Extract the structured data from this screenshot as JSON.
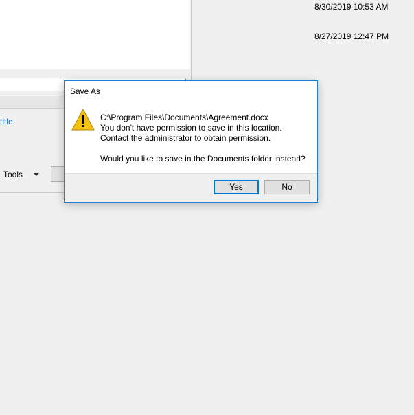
{
  "background": {
    "timestamps": [
      "8/30/2019 10:53 AM",
      "8/27/2019 12:47 PM"
    ],
    "save_dialog": {
      "link_text": "title",
      "tools_label": "Tools"
    }
  },
  "message_box": {
    "title": "Save As",
    "icon": "warning-icon",
    "lines": [
      "C:\\Program Files\\Documents\\Agreement.docx",
      "You don't have permission to save in this location.",
      "Contact the administrator to obtain permission.",
      "Would you like to save in the Documents folder instead?"
    ],
    "buttons": {
      "yes": "Yes",
      "no": "No"
    }
  },
  "colors": {
    "accent": "#0078d7",
    "link": "#0066cc",
    "warning": "#f4c20d"
  }
}
